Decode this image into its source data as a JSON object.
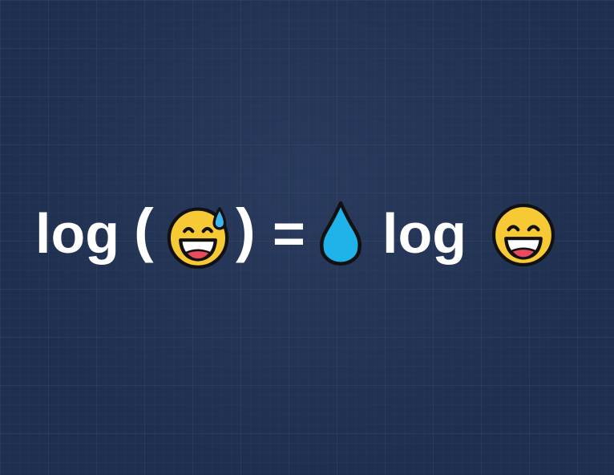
{
  "equation": {
    "left_function": "log",
    "open_paren": "(",
    "close_paren": ")",
    "equals_sign": "=",
    "right_function": "log",
    "left_argument_icon": "grinning-face-with-sweat-icon",
    "coefficient_icon": "water-droplet-icon",
    "right_argument_icon": "grinning-face-icon"
  },
  "colors": {
    "background": "#1f2f4f",
    "text": "#ffffff",
    "emoji_face": "#f7c934",
    "drop": "#1fb3ea"
  }
}
